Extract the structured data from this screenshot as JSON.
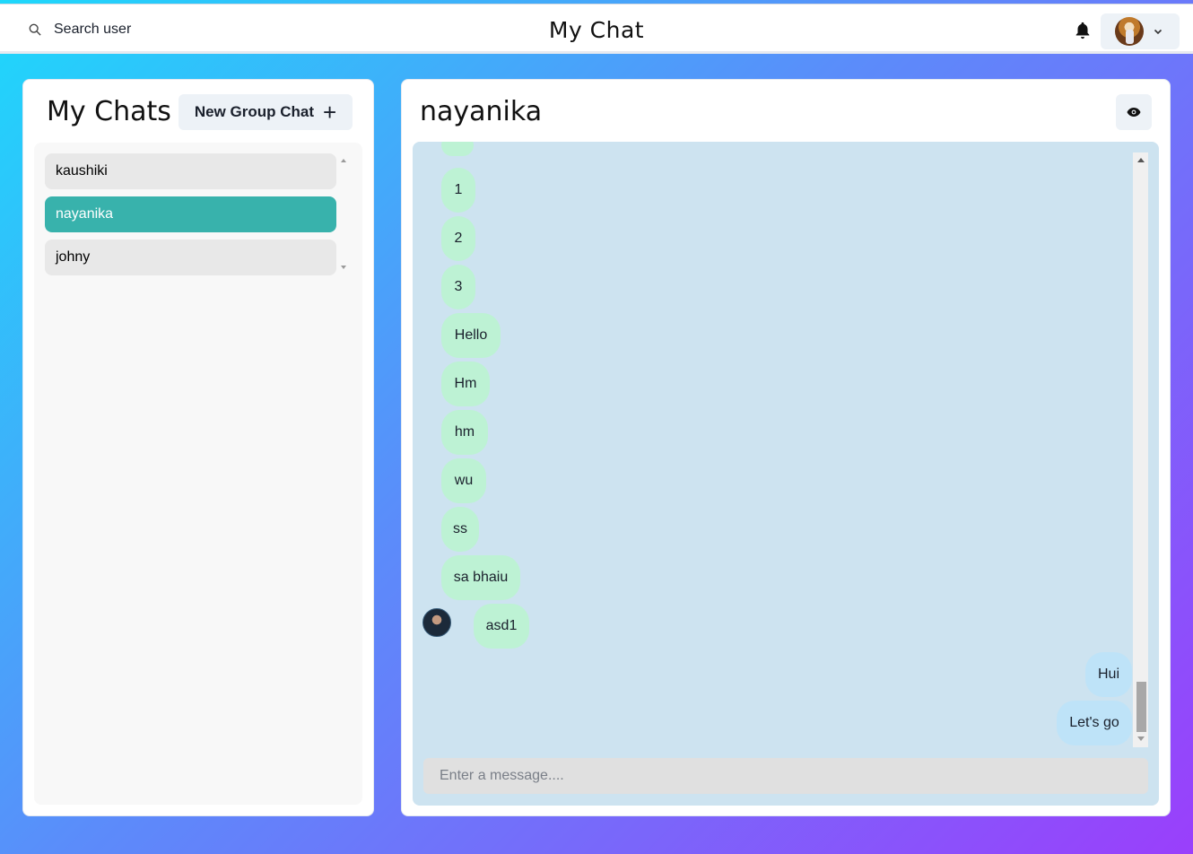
{
  "header": {
    "search_label": "Search user",
    "app_title": "My Chat",
    "icons": {
      "search": "search-icon",
      "bell": "bell-icon",
      "chevron": "chevron-down-icon"
    }
  },
  "sidebar": {
    "title": "My Chats",
    "new_group_label": "New Group Chat",
    "new_group_icon": "+",
    "chats": [
      {
        "name": "kaushiki",
        "active": false
      },
      {
        "name": "nayanika",
        "active": true
      },
      {
        "name": "johny",
        "active": false
      }
    ]
  },
  "chat": {
    "title": "nayanika",
    "view_icon": "eye-icon",
    "messages": [
      {
        "text": "1",
        "sender": "other"
      },
      {
        "text": "2",
        "sender": "other"
      },
      {
        "text": "3",
        "sender": "other"
      },
      {
        "text": "Hello",
        "sender": "other"
      },
      {
        "text": "Hm",
        "sender": "other"
      },
      {
        "text": "hm",
        "sender": "other"
      },
      {
        "text": "wu",
        "sender": "other"
      },
      {
        "text": "ss",
        "sender": "other"
      },
      {
        "text": "sa bhaiu",
        "sender": "other"
      },
      {
        "text": "asd1",
        "sender": "other"
      },
      {
        "text": "Hui",
        "sender": "me"
      },
      {
        "text": "Let's go",
        "sender": "me"
      }
    ],
    "input_placeholder": "Enter a message...."
  },
  "colors": {
    "active_chat": "#38b2ac",
    "other_bubble": "#bdf2d4",
    "my_bubble": "#bee3f8",
    "messages_bg": "#cde3f0"
  }
}
